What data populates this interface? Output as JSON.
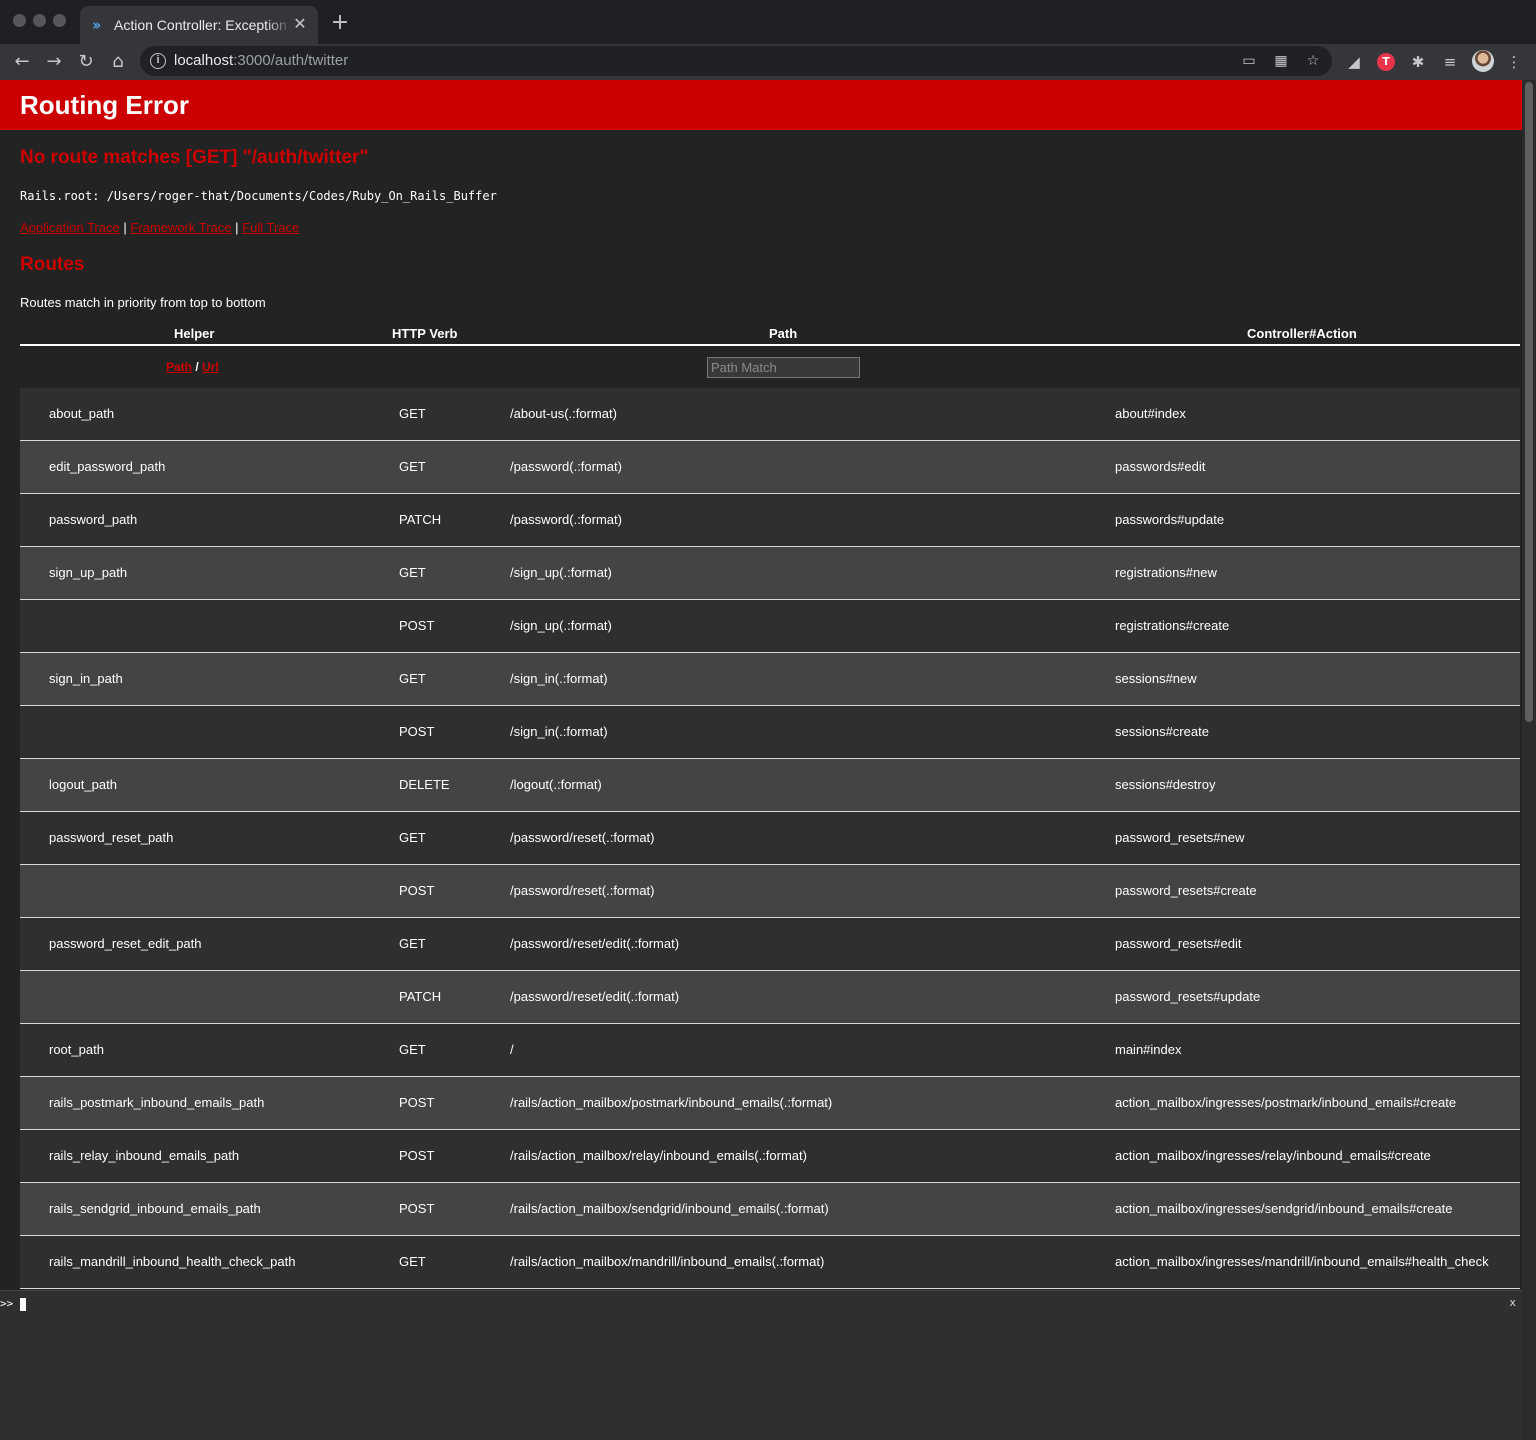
{
  "browser": {
    "tab_title": "Action Controller: Exception caught",
    "url_host": "localhost",
    "url_rest": ":3000/auth/twitter",
    "icons": [
      "back-arrow-icon",
      "forward-arrow-icon",
      "reload-icon",
      "home-icon",
      "cast-icon",
      "grid-icon",
      "star-icon",
      "extension-icon"
    ]
  },
  "page": {
    "header_title": "Routing Error",
    "error_message": "No route matches [GET] \"/auth/twitter\"",
    "rails_root": "Rails.root: /Users/roger-that/Documents/Codes/Ruby_On_Rails_Buffer",
    "traces": {
      "application": "Application Trace",
      "framework": "Framework Trace",
      "full": "Full Trace",
      "sep": "|"
    },
    "routes_heading": "Routes",
    "routes_note": "Routes match in priority from top to bottom",
    "columns": {
      "helper": "Helper",
      "verb": "HTTP Verb",
      "path": "Path",
      "controller": "Controller#Action"
    },
    "filter": {
      "path_link": "Path",
      "slash": "/",
      "url_link": "Url",
      "placeholder": "Path Match"
    },
    "routes": [
      {
        "helper": "about_path",
        "verb": "GET",
        "path": "/about-us(.:format)",
        "action": "about#index"
      },
      {
        "helper": "edit_password_path",
        "verb": "GET",
        "path": "/password(.:format)",
        "action": "passwords#edit"
      },
      {
        "helper": "password_path",
        "verb": "PATCH",
        "path": "/password(.:format)",
        "action": "passwords#update"
      },
      {
        "helper": "sign_up_path",
        "verb": "GET",
        "path": "/sign_up(.:format)",
        "action": "registrations#new"
      },
      {
        "helper": "",
        "verb": "POST",
        "path": "/sign_up(.:format)",
        "action": "registrations#create"
      },
      {
        "helper": "sign_in_path",
        "verb": "GET",
        "path": "/sign_in(.:format)",
        "action": "sessions#new"
      },
      {
        "helper": "",
        "verb": "POST",
        "path": "/sign_in(.:format)",
        "action": "sessions#create"
      },
      {
        "helper": "logout_path",
        "verb": "DELETE",
        "path": "/logout(.:format)",
        "action": "sessions#destroy"
      },
      {
        "helper": "password_reset_path",
        "verb": "GET",
        "path": "/password/reset(.:format)",
        "action": "password_resets#new"
      },
      {
        "helper": "",
        "verb": "POST",
        "path": "/password/reset(.:format)",
        "action": "password_resets#create"
      },
      {
        "helper": "password_reset_edit_path",
        "verb": "GET",
        "path": "/password/reset/edit(.:format)",
        "action": "password_resets#edit"
      },
      {
        "helper": "",
        "verb": "PATCH",
        "path": "/password/reset/edit(.:format)",
        "action": "password_resets#update"
      },
      {
        "helper": "root_path",
        "verb": "GET",
        "path": "/",
        "action": "main#index"
      },
      {
        "helper": "rails_postmark_inbound_emails_path",
        "verb": "POST",
        "path": "/rails/action_mailbox/postmark/inbound_emails(.:format)",
        "action": "action_mailbox/ingresses/postmark/inbound_emails#create"
      },
      {
        "helper": "rails_relay_inbound_emails_path",
        "verb": "POST",
        "path": "/rails/action_mailbox/relay/inbound_emails(.:format)",
        "action": "action_mailbox/ingresses/relay/inbound_emails#create"
      },
      {
        "helper": "rails_sendgrid_inbound_emails_path",
        "verb": "POST",
        "path": "/rails/action_mailbox/sendgrid/inbound_emails(.:format)",
        "action": "action_mailbox/ingresses/sendgrid/inbound_emails#create"
      },
      {
        "helper": "rails_mandrill_inbound_health_check_path",
        "verb": "GET",
        "path": "/rails/action_mailbox/mandrill/inbound_emails(.:format)",
        "action": "action_mailbox/ingresses/mandrill/inbound_emails#health_check"
      }
    ],
    "console": {
      "prompt": ">>",
      "close": "x"
    }
  },
  "colors": {
    "accent_red": "#cc0000",
    "row_odd": "#2f2f2f",
    "row_even": "#444444"
  }
}
